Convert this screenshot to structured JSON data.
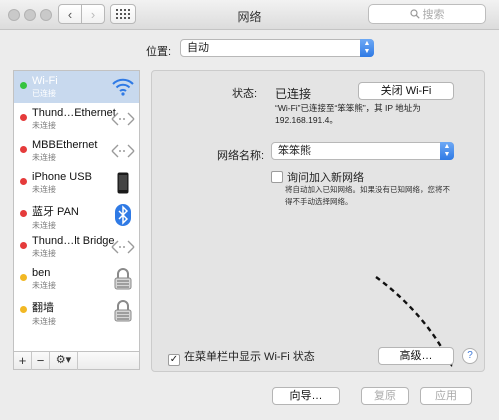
{
  "window": {
    "title": "网络",
    "search_placeholder": "搜索",
    "back_glyph": "‹",
    "forward_glyph": "›"
  },
  "location": {
    "label": "位置:",
    "value": "自动"
  },
  "services": [
    {
      "name": "Wi-Fi",
      "status": "已连接",
      "dot_color": "#35c43f",
      "icon": "wifi-icon",
      "selected": true
    },
    {
      "name": "Thund…Ethernet",
      "status": "未连接",
      "dot_color": "#e53b3b",
      "icon": "ethernet-arrows-icon"
    },
    {
      "name": "MBBEthernet",
      "status": "未连接",
      "dot_color": "#e53b3b",
      "icon": "ethernet-arrows-icon"
    },
    {
      "name": "iPhone USB",
      "status": "未连接",
      "dot_color": "#e53b3b",
      "icon": "iphone-icon"
    },
    {
      "name": "蓝牙 PAN",
      "status": "未连接",
      "dot_color": "#e53b3b",
      "icon": "bluetooth-icon"
    },
    {
      "name": "Thund…lt Bridge",
      "status": "未连接",
      "dot_color": "#e53b3b",
      "icon": "ethernet-arrows-icon"
    },
    {
      "name": "ben",
      "status": "未连接",
      "dot_color": "#f2b824",
      "icon": "lock-icon"
    },
    {
      "name": "翻墙",
      "status": "未连接",
      "dot_color": "#f2b824",
      "icon": "lock-icon"
    }
  ],
  "sidebar_tools": {
    "add": "+",
    "remove": "−",
    "gear": "⚙▾"
  },
  "panel": {
    "status_label": "状态:",
    "status_value": "已连接",
    "turn_off_button": "关闭 Wi-Fi",
    "status_desc_1": "“Wi-Fi”已连接至“笨笨熊”，其 IP 地址为",
    "status_desc_2": "192.168.191.4。",
    "network_name_label": "网络名称:",
    "network_name_value": "笨笨熊",
    "ask_join_label": "询问加入新网络",
    "ask_join_checked": false,
    "ask_join_desc_1": "将自动加入已知网络。如果没有已知网络，您将不",
    "ask_join_desc_2": "得不手动选择网络。",
    "show_menu_label": "在菜单栏中显示 Wi-Fi 状态",
    "show_menu_checked": true,
    "advanced_button": "高级…",
    "help": "?"
  },
  "bottom": {
    "assist_button": "向导…",
    "revert_button": "复原",
    "apply_button": "应用"
  },
  "colors": {
    "selection": "#c8d9ee",
    "accent": "#2f7ae5",
    "connected": "#35c43f",
    "disconnected": "#e53b3b",
    "vpn": "#f2b824"
  }
}
